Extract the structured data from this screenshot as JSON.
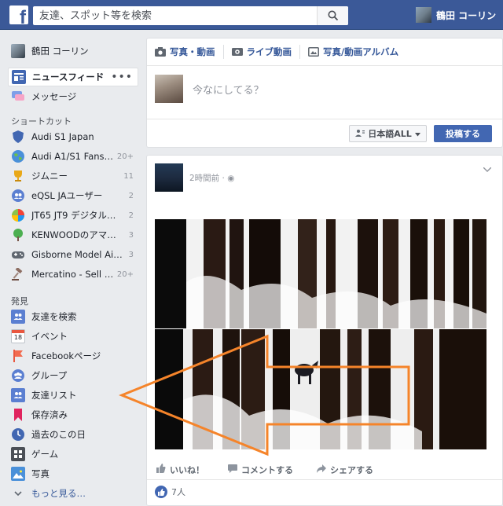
{
  "header": {
    "search_placeholder": "友達、スポット等を検索",
    "username": "鶴田 コーリン"
  },
  "sidebar": {
    "profile_name": "鶴田 コーリン",
    "news_feed": "ニュースフィード",
    "messages": "メッセージ",
    "shortcuts_heading": "ショートカット",
    "shortcuts": [
      {
        "label": "Audi S1 Japan",
        "count": ""
      },
      {
        "label": "Audi A1/S1 Fans & …",
        "count": "20+"
      },
      {
        "label": "ジムニー",
        "count": "11"
      },
      {
        "label": "eQSL JAユーザー",
        "count": "2"
      },
      {
        "label": "JT65 JT9 デジタル…",
        "count": "2"
      },
      {
        "label": "KENWOODのアマ…",
        "count": "3"
      },
      {
        "label": "Gisborne Model Air…",
        "count": "3"
      },
      {
        "label": "Mercatino - Sell an…",
        "count": "20+"
      }
    ],
    "explore_heading": "発見",
    "explore": [
      {
        "label": "友達を検索"
      },
      {
        "label": "イベント"
      },
      {
        "label": "Facebookページ"
      },
      {
        "label": "グループ"
      },
      {
        "label": "友達リスト"
      },
      {
        "label": "保存済み"
      },
      {
        "label": "過去のこの日"
      },
      {
        "label": "ゲーム"
      },
      {
        "label": "写真"
      },
      {
        "label": "もっと見る…"
      }
    ],
    "calendar_day": "18"
  },
  "composer": {
    "tab_photo": "写真・動画",
    "tab_live": "ライブ動画",
    "tab_album": "写真/動画アルバム",
    "prompt": "今なにしてる？",
    "audience": "日本語ALL",
    "post_button": "投稿する"
  },
  "post": {
    "time": "2時間前 ·",
    "like": "いいね！",
    "comment": "コメントする",
    "share": "シェアする",
    "reactions": "7人"
  },
  "colors": {
    "brand": "#3b5998",
    "link": "#365899",
    "annotation_arrow": "#f5842a"
  }
}
